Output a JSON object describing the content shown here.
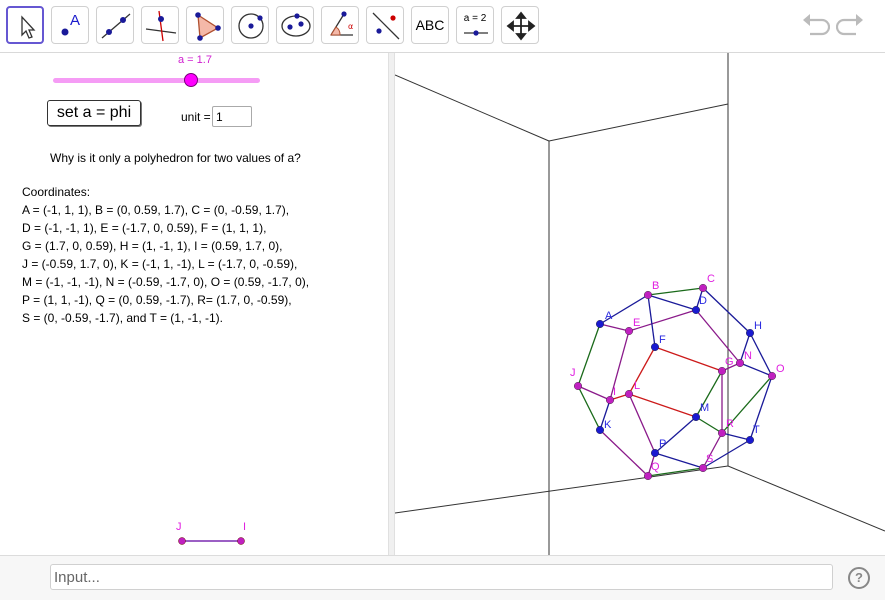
{
  "toolbar": {
    "tools": [
      {
        "name": "move-tool",
        "icon": "cursor-arrow-icon"
      },
      {
        "name": "point-tool",
        "icon": "point-icon",
        "label": "A"
      },
      {
        "name": "line-tool",
        "icon": "line-icon"
      },
      {
        "name": "perpendicular-line-tool",
        "icon": "perpendicular-icon"
      },
      {
        "name": "polygon-tool",
        "icon": "polygon-icon"
      },
      {
        "name": "circle-tool",
        "icon": "circle-icon"
      },
      {
        "name": "ellipse-tool",
        "icon": "ellipse-icon"
      },
      {
        "name": "angle-tool",
        "icon": "angle-icon"
      },
      {
        "name": "reflect-tool",
        "icon": "reflect-icon"
      },
      {
        "name": "text-tool",
        "icon": "text-icon",
        "label": "ABC"
      },
      {
        "name": "slider-tool",
        "icon": "slider-icon",
        "label": "a = 2"
      },
      {
        "name": "move-graphics-tool",
        "icon": "move-view-icon"
      }
    ],
    "undo_icon": "undo-icon",
    "redo_icon": "redo-icon"
  },
  "algebra": {
    "slider": {
      "label": "a = 1.7",
      "value": 1.7,
      "color": "#ff00ff"
    },
    "phi_button": "set a = phi",
    "unit_label": "unit =",
    "unit_value": "1",
    "question": "Why is it only a polyhedron for two values of a?",
    "coordinates_title": "Coordinates:",
    "coordinate_lines": [
      "A = (-1, 1, 1), B = (0, 0.59, 1.7), C = (0, -0.59, 1.7),",
      "D = (-1, -1, 1), E = (-1.7, 0, 0.59), F = (1, 1, 1),",
      "G = (1.7, 0, 0.59), H = (1, -1, 1), I = (0.59, 1.7, 0),",
      "J = (-0.59, 1.7, 0), K = (-1, 1, -1), L = (-1.7, 0, -0.59),",
      "M = (-1, -1, -1), N =  (-0.59, -1.7, 0), O = (0.59, -1.7, 0),",
      "P = (1, 1, -1), Q = (0, 0.59, -1.7), R= (1.7, 0, -0.59),",
      "S = (0, -0.59, -1.7), and T = (1, -1, -1)."
    ],
    "segment": {
      "start_label": "J",
      "end_label": "I"
    }
  },
  "graphics": {
    "point_labels": [
      "A",
      "B",
      "C",
      "D",
      "E",
      "F",
      "G",
      "H",
      "I",
      "J",
      "K",
      "L",
      "M",
      "N",
      "O",
      "P",
      "Q",
      "R",
      "S",
      "T"
    ],
    "colors": {
      "blue_point": "#1a1ad0",
      "magenta_point": "#c020c0",
      "label_blue": "#2a2ae0",
      "label_magenta": "#e020e0"
    }
  },
  "input_bar": {
    "placeholder": "Input...",
    "help_icon": "help-icon",
    "help_glyph": "?"
  }
}
